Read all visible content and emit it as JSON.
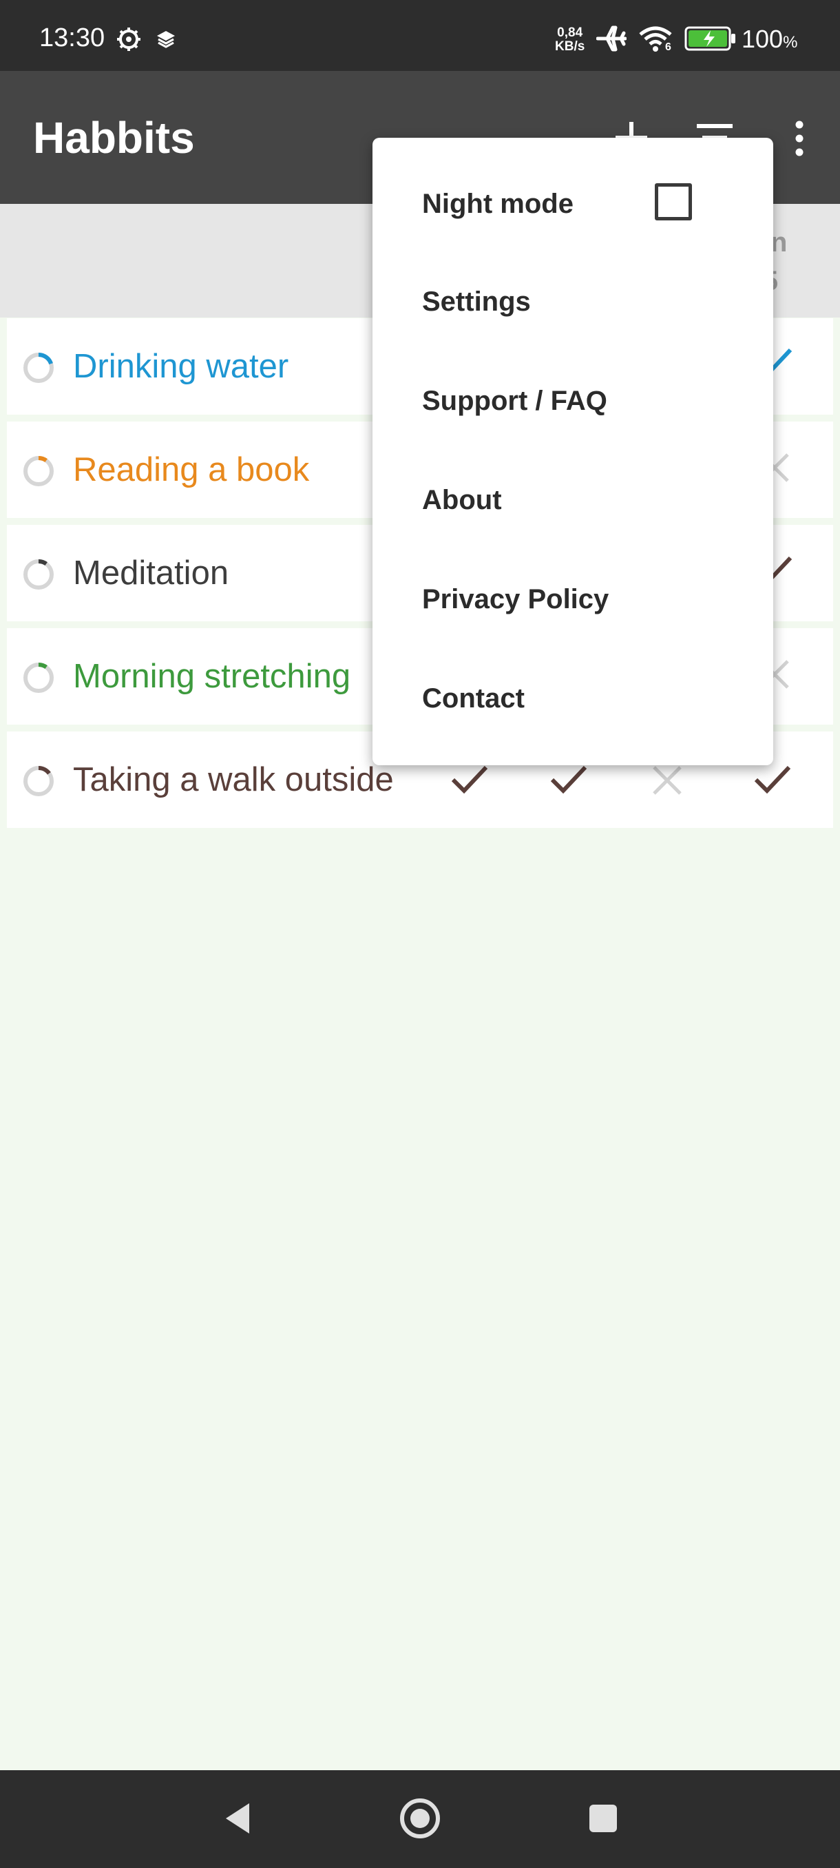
{
  "status_bar": {
    "time": "13:30",
    "net_speed_value": "0,84",
    "net_speed_unit": "KB/s",
    "wifi_badge": "6",
    "battery": "100",
    "battery_unit": "%"
  },
  "app_bar": {
    "title": "Habbits",
    "add_icon": "plus-icon",
    "sort_icon": "sort-icon",
    "overflow_icon": "more-vert-icon"
  },
  "header": {
    "visible_day": "un",
    "visible_date": "5"
  },
  "habits": [
    {
      "name": "Drinking water",
      "color": "#1e96d2",
      "progress": 0.2
    },
    {
      "name": "Reading a book",
      "color": "#e8891d",
      "progress": 0.1
    },
    {
      "name": "Meditation",
      "color": "#3d3d3d",
      "progress": 0.1
    },
    {
      "name": "Morning stretching",
      "color": "#3d9a3d",
      "progress": 0.1
    },
    {
      "name": "Taking a walk outside",
      "color": "#5a3f3a",
      "progress": 0.15
    }
  ],
  "walk_marks": [
    "check",
    "check",
    "cross",
    "check"
  ],
  "menu": {
    "night_mode": "Night mode",
    "night_mode_checked": false,
    "settings": "Settings",
    "support": "Support / FAQ",
    "about": "About",
    "privacy": "Privacy Policy",
    "contact": "Contact"
  },
  "colors": {
    "status_bar": "#2d2d2d",
    "app_bar": "#454545",
    "background": "#f2f9ef",
    "check_mark": "#5a3f3a",
    "cross_mark": "#d2d2d2"
  }
}
